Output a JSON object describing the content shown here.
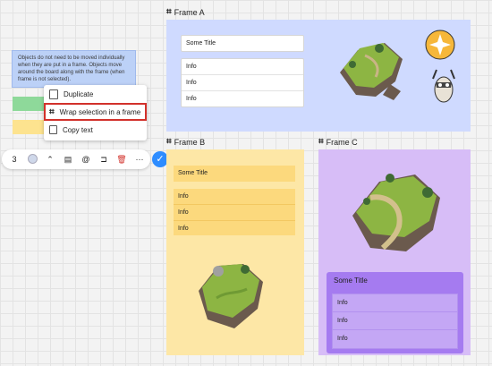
{
  "frames": {
    "a": {
      "label": "Frame A",
      "title": "Some Title",
      "rows": [
        "Info",
        "Info",
        "Info"
      ]
    },
    "b": {
      "label": "Frame B",
      "title": "Some Title",
      "rows": [
        "Info",
        "Info",
        "Info"
      ]
    },
    "c": {
      "label": "Frame C",
      "title": "Some Title",
      "rows": [
        "Info",
        "Info",
        "Info"
      ]
    }
  },
  "note": {
    "text": "Objects do not need to be moved individually when they are put in a frame. Objects move around the board along with the frame (when frame is not selected)."
  },
  "context_menu": {
    "items": [
      "Duplicate",
      "Wrap selection in a frame",
      "Copy text"
    ]
  },
  "toolbar": {
    "count": "3",
    "more": "···"
  },
  "colors": {
    "frame_a": "#cfdaff",
    "frame_b": "#fde7a6",
    "frame_c": "#d7bdf7",
    "accent": "#2d8cff",
    "highlight": "#d2312b"
  },
  "icons": [
    "frame-hash-icon",
    "duplicate-icon",
    "copy-icon",
    "chevron-up-icon",
    "document-icon",
    "at-icon",
    "crop-icon",
    "trash-icon",
    "check-icon"
  ]
}
